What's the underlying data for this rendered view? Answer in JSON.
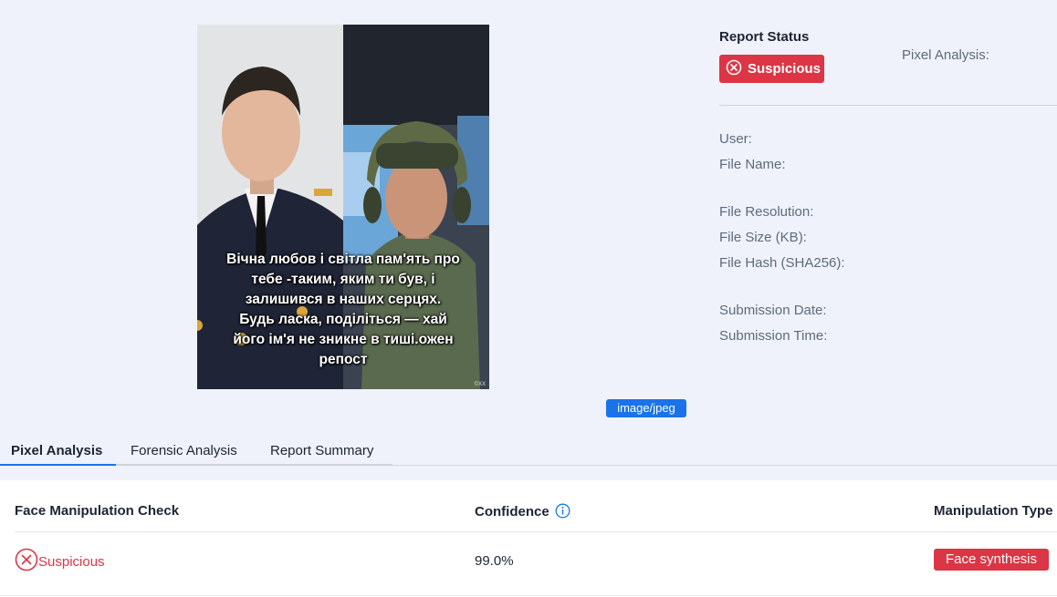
{
  "preview": {
    "caption": "Вічна любов і світла пам'ять про\nтебе -таким, яким ти був, і\nзалишився в наших серцях.\nБудь ласка, поділіться — хай\nйого ім'я не зникне в тиші.ожен\nрепост",
    "watermark": "©XX",
    "mime_type": "image/jpeg"
  },
  "report_status": {
    "title": "Report Status",
    "status": "Suspicious",
    "pixel_analysis_label": "Pixel Analysis:"
  },
  "metadata": {
    "user_label": "User:",
    "file_name_label": "File Name:",
    "file_resolution_label": "File Resolution:",
    "file_size_label": "File Size (KB):",
    "file_hash_label": "File Hash (SHA256):",
    "submission_date_label": "Submission Date:",
    "submission_time_label": "Submission Time:"
  },
  "tabs": [
    {
      "label": "Pixel Analysis",
      "active": true
    },
    {
      "label": "Forensic Analysis",
      "active": false
    },
    {
      "label": "Report Summary",
      "active": false
    }
  ],
  "results_table": {
    "headers": {
      "check": "Face Manipulation Check",
      "confidence": "Confidence",
      "type": "Manipulation Type"
    },
    "rows": [
      {
        "status": "Suspicious",
        "confidence": "99.0%",
        "manipulation_type": "Face synthesis"
      }
    ]
  },
  "colors": {
    "danger": "#dc3545",
    "accent": "#1a73e8",
    "background": "#eff2fb"
  },
  "icons": {
    "status": "circle-x-icon",
    "info": "info-circle-icon"
  }
}
